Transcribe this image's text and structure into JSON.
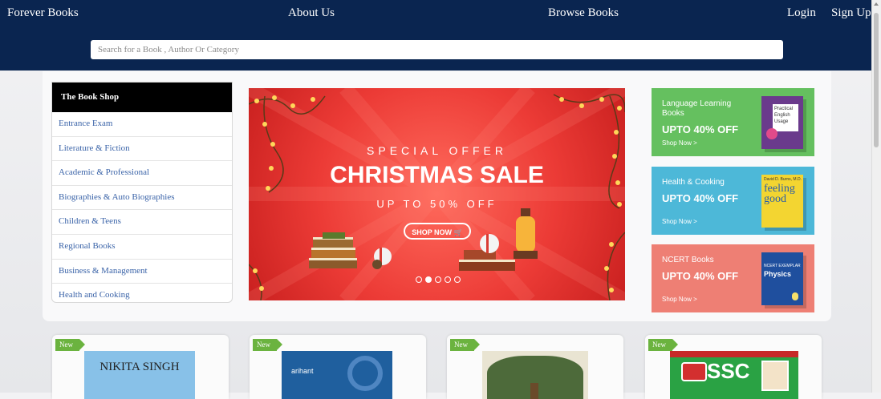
{
  "header": {
    "brand": "Forever Books",
    "about": "About Us",
    "browse": "Browse Books",
    "login": "Login",
    "signup": "Sign Up"
  },
  "search": {
    "placeholder": "Search for a Book , Author Or Category"
  },
  "categories": {
    "title": "The Book Shop",
    "items": [
      "Entrance Exam",
      "Literature & Fiction",
      "Academic & Professional",
      "Biographies & Auto Biographies",
      "Children & Teens",
      "Regional Books",
      "Business & Management",
      "Health and Cooking"
    ]
  },
  "banner": {
    "special": "SPECIAL OFFER",
    "sale": "CHRISTMAS SALE",
    "upto": "UP TO 50% OFF",
    "shop": "SHOP NOW",
    "slides": 5,
    "active_slide": 2
  },
  "promos": [
    {
      "category": "Language Learning Books",
      "offer": "UPTO 40% OFF",
      "cta": "Shop Now >",
      "book_title": "Practical English Usage",
      "color": "#65c05f"
    },
    {
      "category": "Health & Cooking",
      "offer": "UPTO 40% OFF",
      "cta": "Shop Now >",
      "book_title": "feeling good",
      "book_author": "David D. Burns, M.D.",
      "color": "#4db8d8"
    },
    {
      "category": "NCERT Books",
      "offer": "UPTO 40% OFF",
      "cta": "Shop Now >",
      "book_title": "Physics",
      "book_series": "NCERT EXEMPLAR",
      "color": "#ee7f74"
    }
  ],
  "new_books": [
    {
      "badge": "New",
      "cover_text": "NIKITA SINGH"
    },
    {
      "badge": "New",
      "cover_text": "arihant"
    },
    {
      "badge": "New",
      "cover_text": ""
    },
    {
      "badge": "New",
      "cover_text": "SSC"
    }
  ],
  "colors": {
    "nav_bg": "#0a2550",
    "banner_red": "#ec3b36",
    "badge_green": "#6bb33f",
    "link_blue": "#3a63a8"
  }
}
